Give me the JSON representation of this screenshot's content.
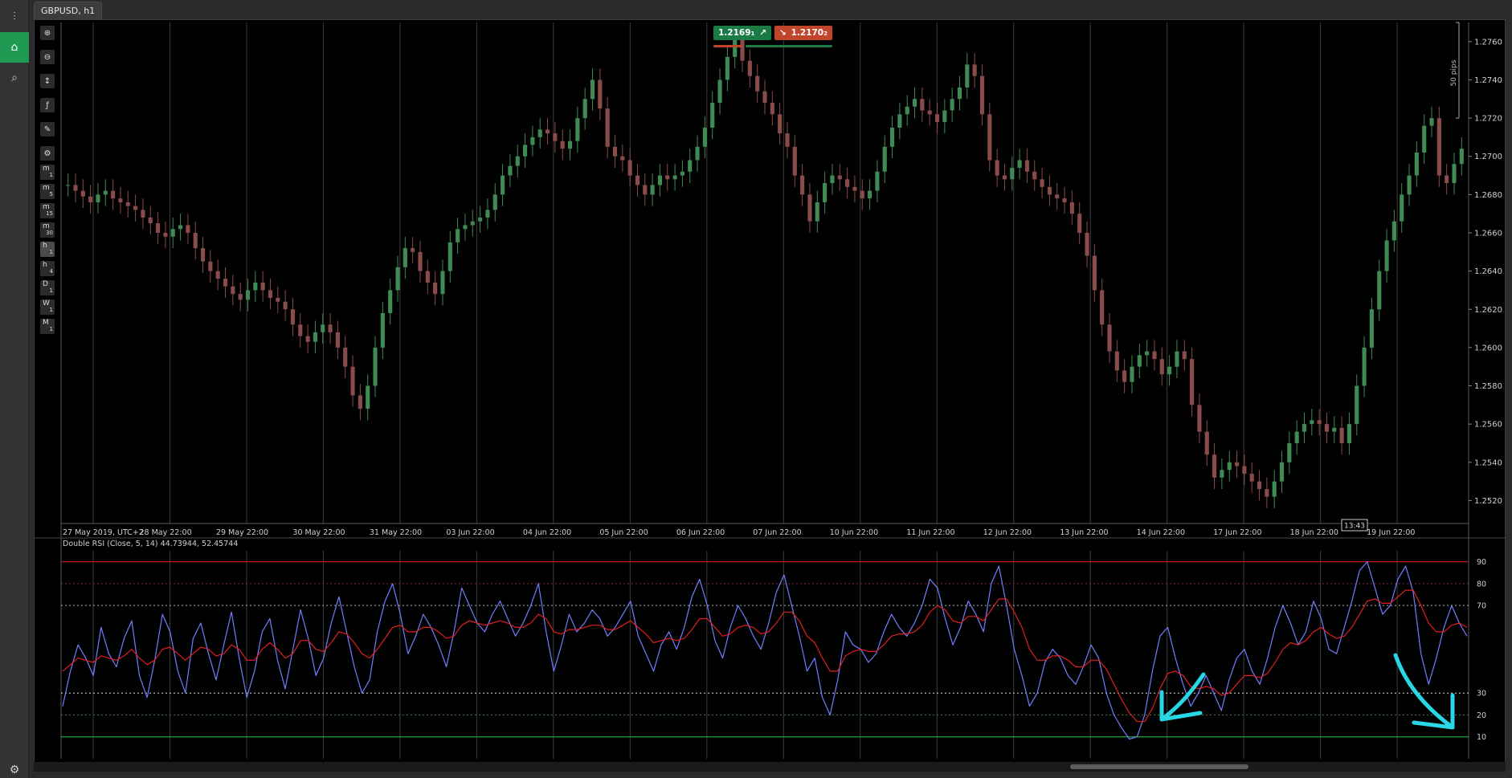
{
  "tab": {
    "title": "GBPUSD, h1"
  },
  "appbar": {
    "items": [
      {
        "icon": "trade-icon"
      },
      {
        "icon": "automate-icon"
      },
      {
        "icon": "analyze-icon"
      },
      {
        "icon": "settings-icon"
      }
    ]
  },
  "toolbar": {
    "tools": [
      {
        "icon": "zoom-in-icon",
        "glyph": "⊕"
      },
      {
        "icon": "zoom-out-icon",
        "glyph": "⊖"
      },
      {
        "icon": "chart-type-icon",
        "glyph": "↕"
      },
      {
        "icon": "indicators-icon",
        "glyph": "ƒ"
      },
      {
        "icon": "drawing-tools-icon",
        "glyph": "✎"
      },
      {
        "icon": "chart-settings-icon",
        "glyph": "⚙"
      }
    ],
    "timeframes": [
      {
        "main": "m",
        "sub": "1"
      },
      {
        "main": "m",
        "sub": "5"
      },
      {
        "main": "m",
        "sub": "15"
      },
      {
        "main": "m",
        "sub": "30"
      },
      {
        "main": "h",
        "sub": "1",
        "active": true
      },
      {
        "main": "h",
        "sub": "4"
      },
      {
        "main": "D",
        "sub": "1"
      },
      {
        "main": "W",
        "sub": "1"
      },
      {
        "main": "M",
        "sub": "1"
      }
    ]
  },
  "quote": {
    "bid": "1.2169",
    "bid_pip": "1",
    "ask": "1.2170",
    "ask_pip": "2",
    "bid_color": "#1c7a45",
    "ask_color": "#c0452a"
  },
  "price_axis": {
    "labels": [
      "1.2760",
      "1.2740",
      "1.2720",
      "1.2700",
      "1.2680",
      "1.2660",
      "1.2640",
      "1.2620",
      "1.2600",
      "1.2580",
      "1.2560",
      "1.2540",
      "1.2520"
    ],
    "pips_label": "50 pips",
    "ylim": [
      1.2508,
      1.277
    ]
  },
  "time_axis": {
    "labels": [
      "27 May 2019, UTC+2",
      "28 May 22:00",
      "29 May 22:00",
      "30 May 22:00",
      "31 May 22:00",
      "03 Jun 22:00",
      "04 Jun 22:00",
      "05 Jun 22:00",
      "06 Jun 22:00",
      "07 Jun 22:00",
      "10 Jun 22:00",
      "11 Jun 22:00",
      "12 Jun 22:00",
      "13 Jun 22:00",
      "14 Jun 22:00",
      "17 Jun 22:00",
      "18 Jun 22:00",
      "19 Jun 22:00"
    ],
    "cursor_time": "13:43"
  },
  "indicator": {
    "label": "Double RSI (Close, 5, 14) 44.73944, 52.45744",
    "levels": [
      "90",
      "80",
      "70",
      "30",
      "20",
      "10"
    ]
  },
  "chart_data": {
    "type": "line",
    "title": "",
    "price_series": {
      "name": "",
      "step": "1 bar = 1 hour",
      "closes": [
        1.2685,
        1.2682,
        1.2679,
        1.2676,
        1.268,
        1.2682,
        1.2678,
        1.2676,
        1.2674,
        1.2672,
        1.2668,
        1.2665,
        1.266,
        1.2658,
        1.2662,
        1.2664,
        1.266,
        1.2652,
        1.2645,
        1.264,
        1.2636,
        1.2632,
        1.2628,
        1.2625,
        1.263,
        1.2634,
        1.263,
        1.2626,
        1.2624,
        1.262,
        1.2612,
        1.2606,
        1.2603,
        1.2608,
        1.2612,
        1.2608,
        1.26,
        1.259,
        1.2575,
        1.2568,
        1.258,
        1.26,
        1.2618,
        1.263,
        1.2642,
        1.2652,
        1.265,
        1.264,
        1.2634,
        1.2628,
        1.264,
        1.2655,
        1.2662,
        1.2664,
        1.2666,
        1.2668,
        1.2672,
        1.268,
        1.269,
        1.2695,
        1.27,
        1.2706,
        1.271,
        1.2714,
        1.2712,
        1.2708,
        1.2704,
        1.2708,
        1.272,
        1.273,
        1.274,
        1.2725,
        1.2705,
        1.27,
        1.2698,
        1.269,
        1.2685,
        1.268,
        1.2685,
        1.269,
        1.2688,
        1.269,
        1.2692,
        1.2698,
        1.2705,
        1.2715,
        1.2728,
        1.274,
        1.2752,
        1.2762,
        1.275,
        1.2742,
        1.2734,
        1.2728,
        1.2722,
        1.2712,
        1.2705,
        1.269,
        1.268,
        1.2666,
        1.2676,
        1.2686,
        1.269,
        1.2688,
        1.2684,
        1.2682,
        1.2678,
        1.2682,
        1.2692,
        1.2705,
        1.2715,
        1.2722,
        1.2726,
        1.273,
        1.2724,
        1.2722,
        1.2718,
        1.2724,
        1.273,
        1.2736,
        1.2748,
        1.2742,
        1.2722,
        1.2698,
        1.269,
        1.2688,
        1.2694,
        1.2698,
        1.2692,
        1.2688,
        1.2684,
        1.268,
        1.2678,
        1.2676,
        1.267,
        1.266,
        1.2648,
        1.263,
        1.2612,
        1.2598,
        1.2588,
        1.2582,
        1.259,
        1.2596,
        1.2598,
        1.2594,
        1.2586,
        1.259,
        1.2598,
        1.2594,
        1.257,
        1.2556,
        1.2544,
        1.2532,
        1.2536,
        1.254,
        1.2538,
        1.2534,
        1.253,
        1.2526,
        1.2522,
        1.253,
        1.254,
        1.255,
        1.2556,
        1.256,
        1.2562,
        1.256,
        1.2556,
        1.2558,
        1.255,
        1.256,
        1.258,
        1.26,
        1.262,
        1.264,
        1.2656,
        1.2666,
        1.268,
        1.269,
        1.2702,
        1.2716,
        1.272,
        1.269,
        1.2686,
        1.2696,
        1.2704
      ]
    },
    "rsi_fast": {
      "name": "",
      "color": "#6f7fff",
      "values": [
        24,
        40,
        52,
        46,
        38,
        60,
        48,
        42,
        55,
        63,
        38,
        28,
        45,
        66,
        58,
        40,
        30,
        55,
        62,
        48,
        36,
        52,
        67,
        46,
        28,
        40,
        58,
        64,
        45,
        32,
        50,
        68,
        55,
        38,
        46,
        62,
        74,
        58,
        42,
        30,
        36,
        58,
        72,
        80,
        66,
        48,
        56,
        66,
        60,
        52,
        42,
        58,
        78,
        70,
        62,
        58,
        66,
        72,
        64,
        56,
        62,
        70,
        80,
        58,
        40,
        52,
        66,
        58,
        62,
        68,
        64,
        56,
        60,
        66,
        72,
        56,
        48,
        40,
        52,
        58,
        50,
        60,
        74,
        82,
        70,
        54,
        46,
        60,
        70,
        64,
        56,
        50,
        62,
        76,
        84,
        70,
        56,
        40,
        46,
        28,
        20,
        36,
        58,
        52,
        50,
        44,
        48,
        58,
        66,
        60,
        56,
        62,
        70,
        82,
        78,
        64,
        52,
        60,
        72,
        66,
        58,
        80,
        88,
        70,
        50,
        38,
        24,
        30,
        44,
        50,
        46,
        38,
        34,
        42,
        52,
        46,
        30,
        20,
        14,
        9,
        10,
        20,
        40,
        56,
        60,
        46,
        34,
        24,
        30,
        38,
        30,
        22,
        36,
        46,
        50,
        40,
        34,
        46,
        60,
        70,
        62,
        52,
        58,
        72,
        64,
        50,
        48,
        60,
        72,
        86,
        90,
        78,
        66,
        70,
        82,
        88,
        76,
        48,
        34,
        46,
        60,
        70,
        62,
        56
      ]
    },
    "rsi_slow": {
      "name": "",
      "color": "#e21f1f",
      "values": [
        40,
        43,
        46,
        45,
        44,
        47,
        46,
        45,
        47,
        50,
        46,
        43,
        45,
        50,
        51,
        48,
        45,
        48,
        51,
        50,
        47,
        48,
        52,
        50,
        45,
        45,
        50,
        53,
        50,
        46,
        48,
        54,
        54,
        50,
        49,
        53,
        58,
        57,
        53,
        48,
        46,
        50,
        55,
        60,
        61,
        58,
        58,
        60,
        60,
        58,
        55,
        56,
        61,
        63,
        62,
        61,
        62,
        63,
        62,
        60,
        60,
        62,
        66,
        64,
        58,
        57,
        59,
        59,
        60,
        61,
        61,
        59,
        59,
        61,
        63,
        60,
        57,
        53,
        54,
        55,
        54,
        55,
        59,
        64,
        64,
        60,
        56,
        57,
        60,
        61,
        60,
        57,
        58,
        62,
        67,
        67,
        63,
        56,
        53,
        46,
        40,
        40,
        47,
        49,
        50,
        49,
        49,
        52,
        56,
        57,
        57,
        58,
        61,
        67,
        70,
        68,
        63,
        62,
        65,
        65,
        63,
        68,
        73,
        73,
        67,
        60,
        50,
        45,
        45,
        47,
        47,
        45,
        42,
        42,
        45,
        45,
        41,
        34,
        27,
        21,
        17,
        17,
        23,
        32,
        39,
        40,
        38,
        33,
        32,
        33,
        32,
        29,
        30,
        34,
        38,
        38,
        37,
        39,
        44,
        50,
        53,
        52,
        54,
        58,
        60,
        57,
        55,
        56,
        60,
        66,
        72,
        73,
        71,
        71,
        74,
        77,
        77,
        70,
        62,
        58,
        58,
        61,
        62,
        60
      ]
    },
    "rsi_ylim": [
      0,
      95
    ],
    "level_lines": [
      90,
      80,
      70,
      30,
      20,
      10
    ],
    "grid": true,
    "legend": "none"
  }
}
